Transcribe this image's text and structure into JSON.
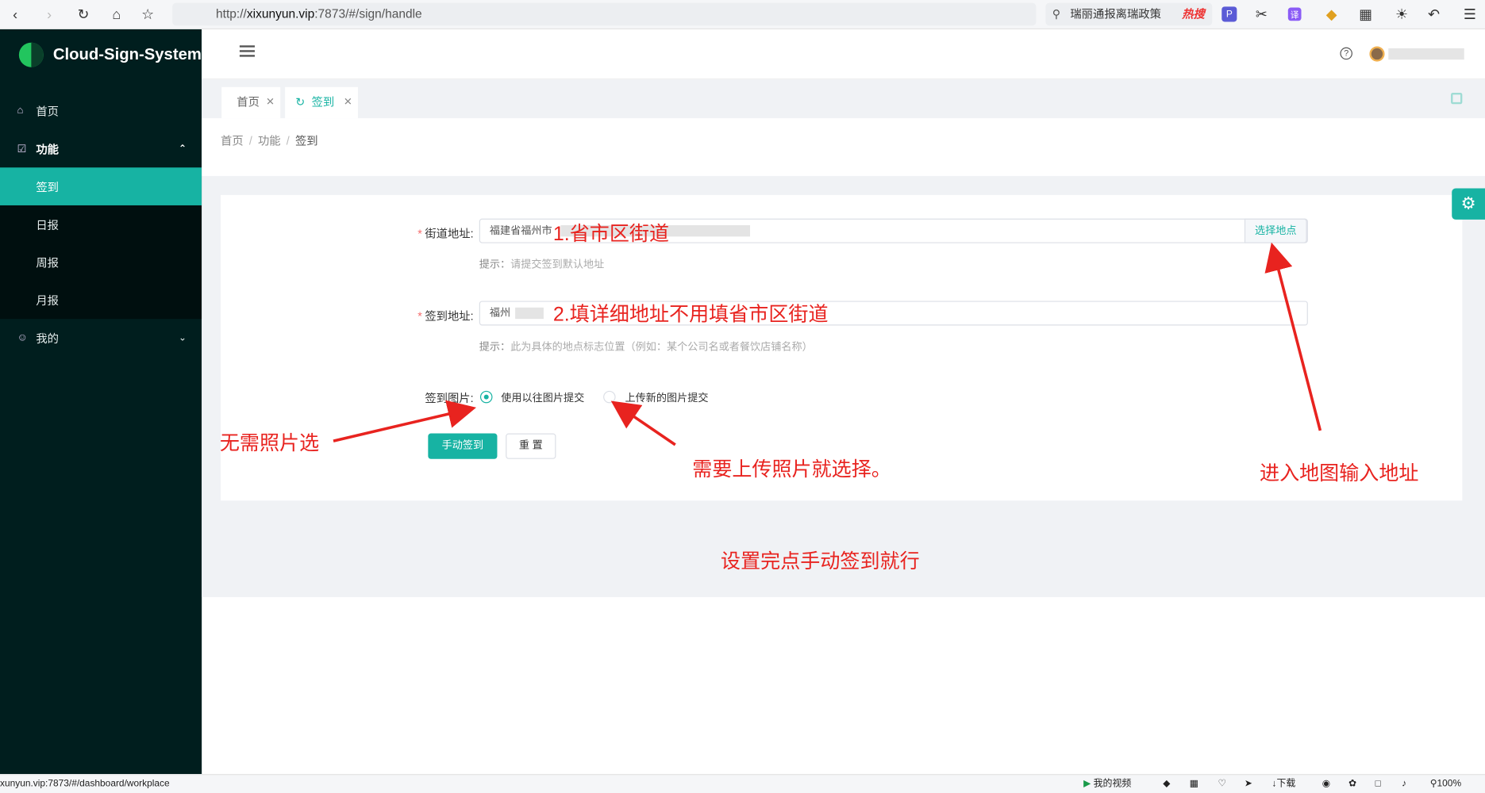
{
  "browser": {
    "url_prefix": "http://",
    "url_domain": "xixunyun.vip",
    "url_rest": ":7873/#/sign/handle",
    "search_text": "瑞丽通报离瑞政策",
    "search_hot": "热搜"
  },
  "app": {
    "title": "Cloud-Sign-System"
  },
  "sidebar": {
    "items": [
      {
        "label": "首页"
      },
      {
        "label": "功能"
      },
      {
        "label": "签到"
      },
      {
        "label": "日报"
      },
      {
        "label": "周报"
      },
      {
        "label": "月报"
      },
      {
        "label": "我的"
      }
    ]
  },
  "tabs": [
    {
      "label": "首页"
    },
    {
      "label": "签到"
    }
  ],
  "breadcrumb": {
    "items": [
      "首页",
      "功能",
      "签到"
    ],
    "separator": "/"
  },
  "form": {
    "street_label": "街道地址:",
    "street_value": "福建省福州市",
    "street_addon": "选择地点",
    "street_hint_prefix": "提示：",
    "street_hint": "请提交签到默认地址",
    "sign_label": "签到地址:",
    "sign_value": "福州",
    "sign_hint_prefix": "提示：",
    "sign_hint": "此为具体的地点标志位置（例如：某个公司名或者餐饮店铺名称）",
    "photo_label": "签到图片:",
    "radio_old": "使用以往图片提交",
    "radio_new": "上传新的图片提交",
    "submit": "手动签到",
    "reset": "重 置"
  },
  "annotations": {
    "a1": "1.省市区街道",
    "a2": "2.填详细地址不用填省市区街道",
    "a3": "无需照片选",
    "a4": "需要上传照片就选择。",
    "a5": "进入地图输入地址",
    "a6": "设置完点手动签到就行"
  },
  "status": {
    "url": "xunyun.vip:7873/#/dashboard/workplace",
    "video": "我的视频",
    "download": "下载",
    "zoom": "100%"
  },
  "colors": {
    "accent": "#17b3a3",
    "sidebar": "#001e1e",
    "annotation": "#e8231f"
  }
}
